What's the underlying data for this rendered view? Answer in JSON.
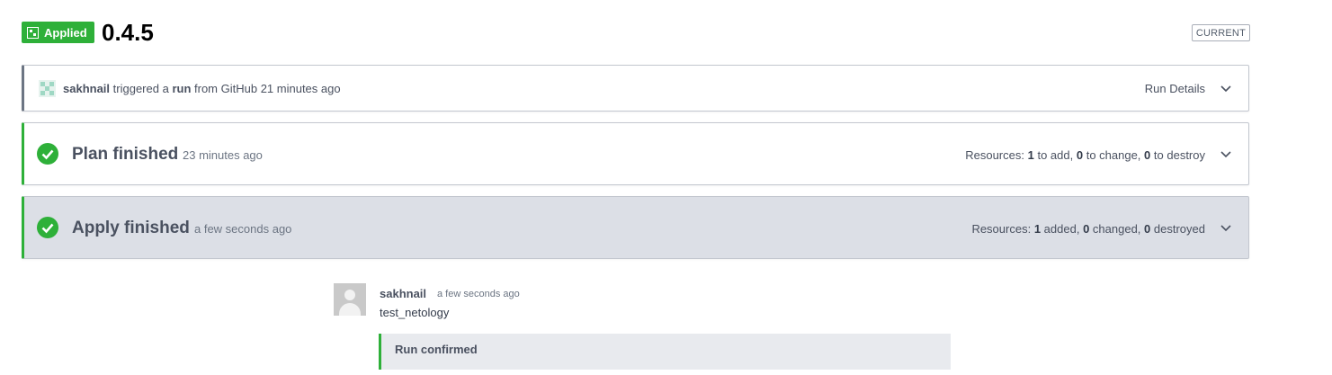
{
  "header": {
    "status_badge": "Applied",
    "version": "0.4.5",
    "current_label": "CURRENT"
  },
  "trigger": {
    "user": "sakhnail",
    "text1": "triggered a",
    "run_word": "run",
    "text2": "from GitHub 21 minutes ago",
    "details_label": "Run Details"
  },
  "plan": {
    "title": "Plan finished",
    "time": "23 minutes ago",
    "resources_prefix": "Resources:",
    "add_count": "1",
    "add_label": "to add,",
    "change_count": "0",
    "change_label": "to change,",
    "destroy_count": "0",
    "destroy_label": "to destroy"
  },
  "apply": {
    "title": "Apply finished",
    "time": "a few seconds ago",
    "resources_prefix": "Resources:",
    "added_count": "1",
    "added_label": "added,",
    "changed_count": "0",
    "changed_label": "changed,",
    "destroyed_count": "0",
    "destroyed_label": "destroyed"
  },
  "comment": {
    "user": "sakhnail",
    "time": "a few seconds ago",
    "text": "test_netology",
    "confirm": "Run confirmed"
  },
  "colors": {
    "success": "#2eb039",
    "apply_bg": "#dcdfe6"
  },
  "icons": [
    "applied-badge-icon",
    "avatar-icon",
    "chevron-down-icon",
    "check-circle-icon",
    "user-avatar-icon"
  ]
}
